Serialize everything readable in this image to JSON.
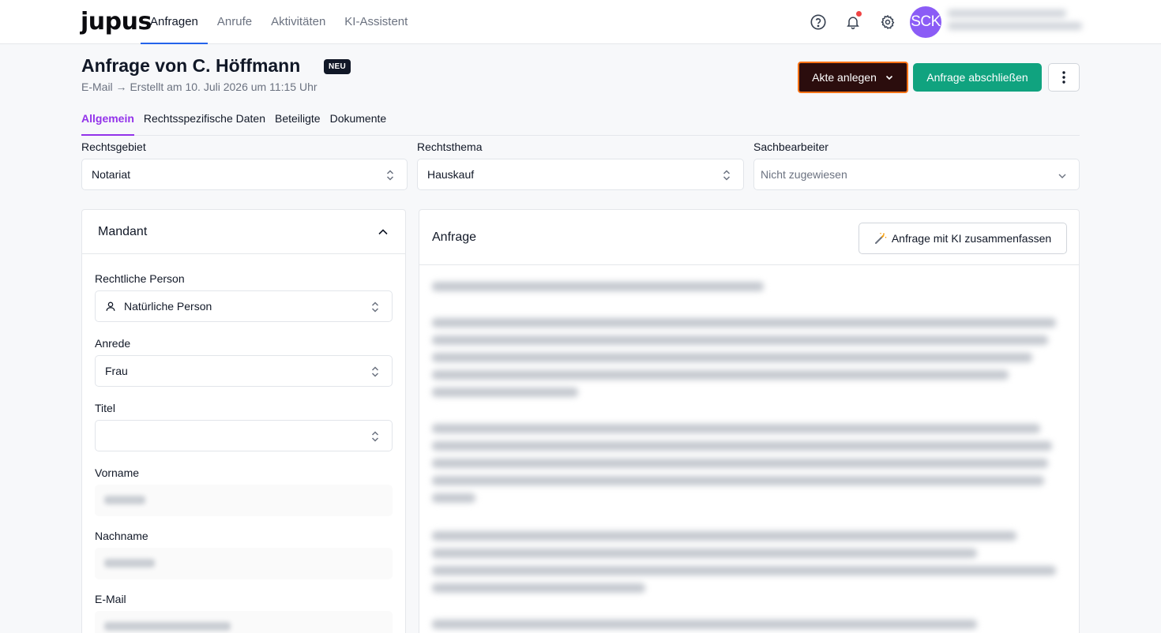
{
  "nav": {
    "logo": "jupus",
    "links": [
      "Anfragen",
      "Anrufe",
      "Aktivitäten",
      "KI-Assistent"
    ],
    "avatar_initials": "SCK"
  },
  "header": {
    "title": "Anfrage von C. Höffmann",
    "badge": "NEU",
    "subtitle": "E-Mail → Erstellt am 10. Juli 2026 um 11:15 Uhr",
    "akte_label": "Akte anlegen",
    "abschliessen_label": "Anfrage abschließen"
  },
  "tabs": [
    "Allgemein",
    "Rechtsspezifische Daten",
    "Beteiligte",
    "Dokumente"
  ],
  "fields": {
    "rechtsgebiet": {
      "label": "Rechtsgebiet",
      "value": "Notariat"
    },
    "rechtsthema": {
      "label": "Rechtsthema",
      "value": "Hauskauf"
    },
    "sachbearbeiter": {
      "label": "Sachbearbeiter",
      "placeholder": "Nicht zugewiesen"
    }
  },
  "mandant": {
    "title": "Mandant",
    "rechtliche_person_label": "Rechtliche Person",
    "rechtliche_person_value": "Natürliche Person",
    "anrede_label": "Anrede",
    "anrede_value": "Frau",
    "titel_label": "Titel",
    "vorname_label": "Vorname",
    "nachname_label": "Nachname",
    "email_label": "E-Mail"
  },
  "anfrage": {
    "title": "Anfrage",
    "ki_button": "Anfrage mit KI zusammenfassen"
  },
  "colors": {
    "accent_purple": "#9333ea",
    "primary_green": "#10a37f",
    "akte_dark": "#2b0d0d",
    "avatar": "#8b5cf6"
  }
}
